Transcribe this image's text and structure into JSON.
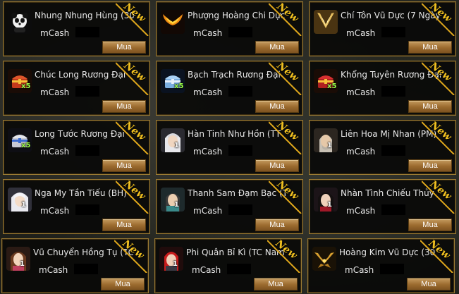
{
  "currency_label": "mCash",
  "buy_label": "Mua",
  "new_badge_label": "New",
  "colors": {
    "card_border": "#9b7a33",
    "badge": "#f0c020",
    "button": "#9b6a2e"
  },
  "items": [
    {
      "name": "Nhung Nhung Hùng (30",
      "icon": "panda-icon",
      "qty": "",
      "price": ""
    },
    {
      "name": "Phượng Hoàng Chi Dực",
      "icon": "phoenix-wings-icon",
      "qty": "",
      "price": ""
    },
    {
      "name": "Chí Tôn Vũ Dực (7 Ngày",
      "icon": "golden-wings-icon",
      "qty": "",
      "price": ""
    },
    {
      "name": "Chúc Long Rương Đại",
      "icon": "treasure-chest-icon",
      "qty": "x5",
      "price": ""
    },
    {
      "name": "Bạch Trạch Rương Đại",
      "icon": "treasure-chest-icon",
      "qty": "x5",
      "price": ""
    },
    {
      "name": "Khổng Tuyên Rương Đại",
      "icon": "treasure-chest-icon",
      "qty": "x5",
      "price": ""
    },
    {
      "name": "Long Tước Rương Đại",
      "icon": "treasure-chest-icon",
      "qty": "x5",
      "price": ""
    },
    {
      "name": "Hàn Tinh Như Hồn (TT",
      "icon": "character-portrait-icon",
      "qty": "1",
      "price": ""
    },
    {
      "name": "Liên Hoa Mị Nhan (PM)",
      "icon": "character-portrait-icon",
      "qty": "1",
      "price": ""
    },
    {
      "name": "Nga My Tần Tiếu (BH)",
      "icon": "character-portrait-icon",
      "qty": "1",
      "price": ""
    },
    {
      "name": "Thanh Sam Đạm Bạc (T",
      "icon": "character-portrait-icon",
      "qty": "1",
      "price": ""
    },
    {
      "name": "Nhàn Tình Chiếu Thủy",
      "icon": "character-portrait-icon",
      "qty": "1",
      "price": ""
    },
    {
      "name": "Vũ Chuyển Hồng Tụ (TC",
      "icon": "character-portrait-icon",
      "qty": "1",
      "price": ""
    },
    {
      "name": "Phi Quân Bỉ Kì (TC Nam",
      "icon": "character-portrait-icon",
      "qty": "1",
      "price": ""
    },
    {
      "name": "Hoàng Kim Vũ Dực (30",
      "icon": "golden-wings-icon",
      "qty": "",
      "price": ""
    }
  ]
}
